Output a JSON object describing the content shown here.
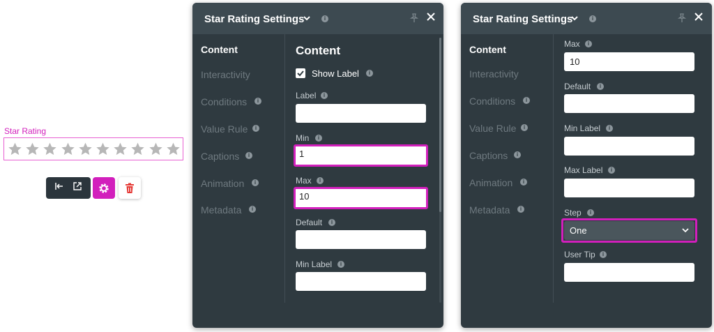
{
  "widget": {
    "label": "Star Rating",
    "star_count": 10,
    "star_color": "#b7b7b7",
    "accent": "#d21fbc",
    "toolbar": {
      "dock_icon": "dock-left-icon",
      "popout_icon": "external-link-icon",
      "gear_icon": "gear-icon",
      "trash_icon": "trash-icon"
    }
  },
  "panel1": {
    "title": "Star Rating Settings",
    "nav": [
      "Content",
      "Interactivity",
      "Conditions",
      "Value Rule",
      "Captions",
      "Animation",
      "Metadata"
    ],
    "section_title": "Content",
    "show_label": "Show Label",
    "label_field": "Label",
    "min_label": "Min",
    "min_value": "1",
    "max_label": "Max",
    "max_value": "10",
    "default_label": "Default",
    "min_label_label": "Min Label"
  },
  "panel2": {
    "title": "Star Rating Settings",
    "nav": [
      "Content",
      "Interactivity",
      "Conditions",
      "Value Rule",
      "Captions",
      "Animation",
      "Metadata"
    ],
    "max_label": "Max",
    "max_value": "10",
    "default_label": "Default",
    "min_label_label": "Min Label",
    "max_label_label": "Max Label",
    "step_label": "Step",
    "step_value": "One",
    "user_tip_label": "User Tip"
  }
}
